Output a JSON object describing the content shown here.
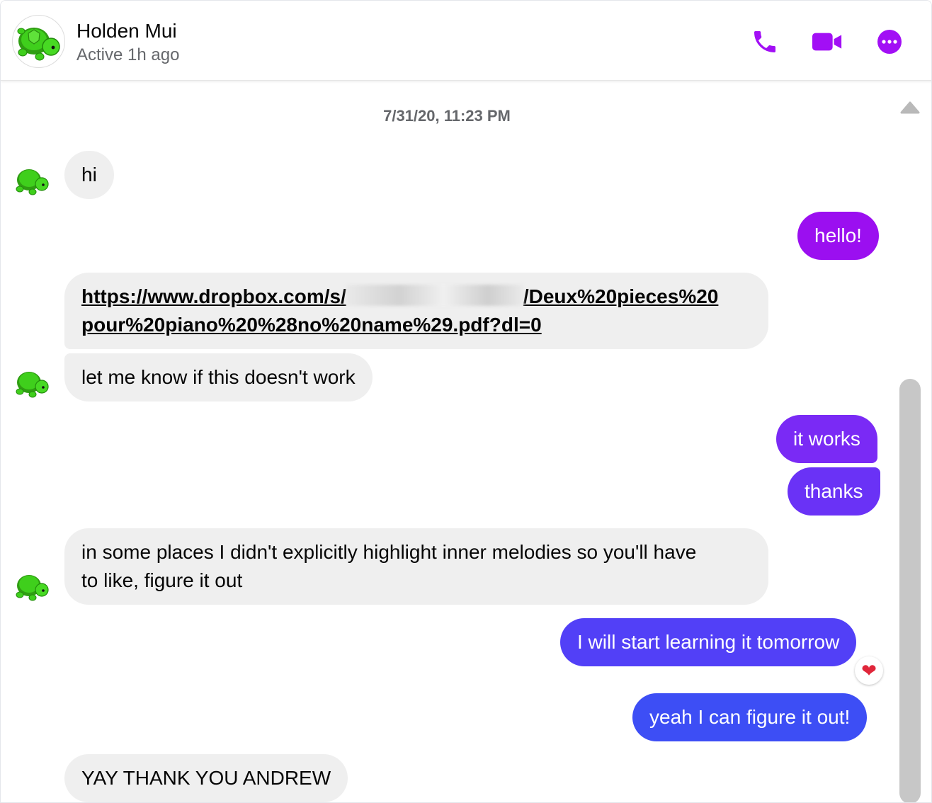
{
  "header": {
    "name": "Holden Mui",
    "status": "Active 1h ago",
    "avatar_icon": "turtle-avatar-icon",
    "actions": [
      {
        "icon": "phone-icon"
      },
      {
        "icon": "video-camera-icon"
      },
      {
        "icon": "more-options-icon"
      }
    ]
  },
  "colors": {
    "accent": "#a20ff5",
    "incoming_bubble": "#efefef",
    "outgoing_purple": "#9b0ff0",
    "outgoing_violet": "#7a2af5",
    "outgoing_indigo": "#5240f7",
    "outgoing_blue": "#3d4ef5",
    "reaction_heart": "#e0263a"
  },
  "thread": {
    "timestamp": "7/31/20, 11:23 PM",
    "messages": [
      {
        "from": "Holden Mui",
        "text": "hi"
      },
      {
        "from": "me",
        "text": "hello!"
      },
      {
        "from": "Holden Mui",
        "link_part1": "https://www.dropbox.com/s/",
        "link_part2": "/Deux%20pieces%20",
        "link_part3": "pour%20piano%20%28no%20name%29.pdf?dl=0",
        "link_redacted": true
      },
      {
        "from": "Holden Mui",
        "text": "let me know if this doesn't work"
      },
      {
        "from": "me",
        "text": "it works"
      },
      {
        "from": "me",
        "text": "thanks"
      },
      {
        "from": "Holden Mui",
        "line1": "in some places I didn't explicitly highlight inner melodies so you'll have",
        "line2": "to like, figure it out"
      },
      {
        "from": "me",
        "text": "I will start learning it tomorrow",
        "reaction": "❤"
      },
      {
        "from": "me",
        "text": "yeah I can figure it out!"
      },
      {
        "from": "Holden Mui",
        "text": "YAY THANK YOU ANDREW"
      }
    ]
  }
}
